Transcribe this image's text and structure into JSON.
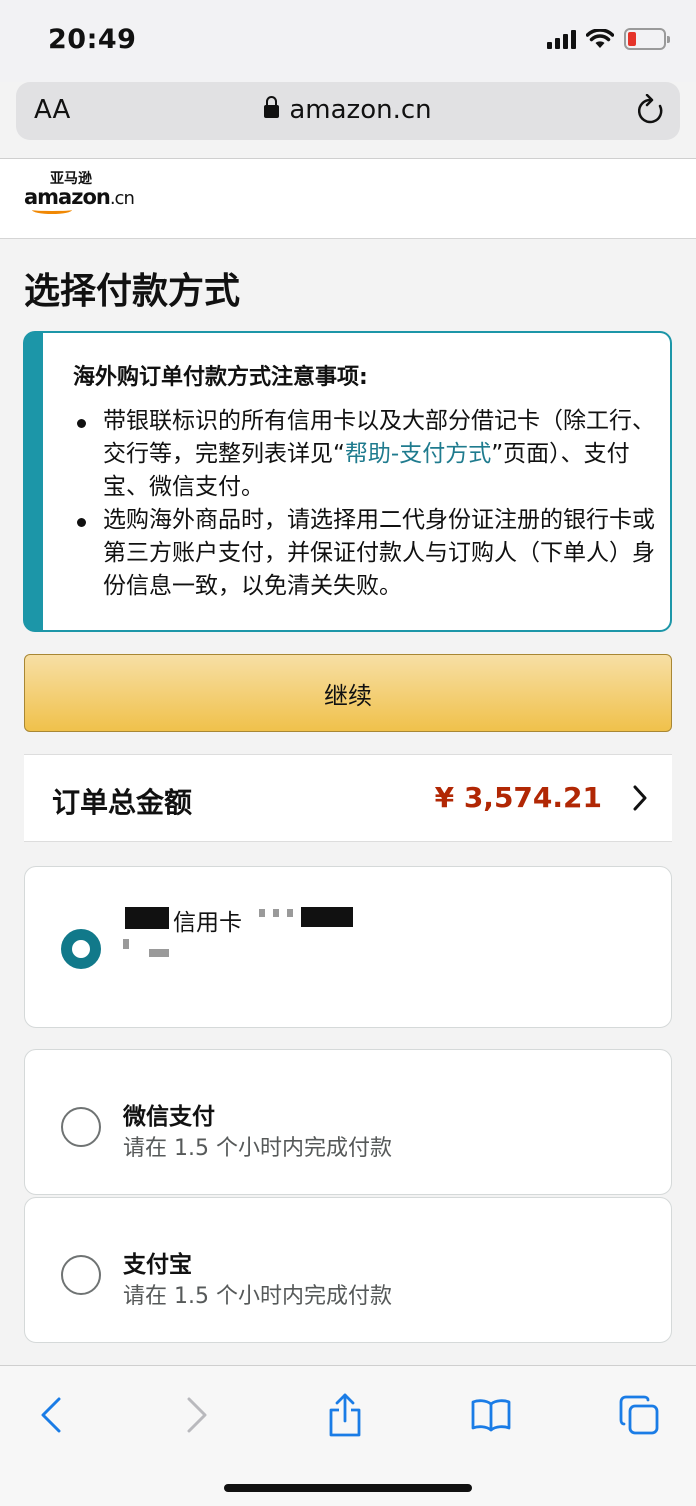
{
  "status_bar": {
    "time": "20:49",
    "battery_color": "#e5342a"
  },
  "browser": {
    "aa_label": "AA",
    "url": "amazon.cn"
  },
  "amazon": {
    "logo_cn": "亚马逊",
    "logo_word": "amazon",
    "logo_suffix": ".cn"
  },
  "page": {
    "title": "选择付款方式"
  },
  "notice": {
    "title": "海外购订单付款方式注意事项:",
    "item1_pre": "带银联标识的所有信用卡以及大部分借记卡（除工行、交行等，完整列表详见“",
    "item1_link": "帮助-支付方式",
    "item1_post": "”页面）、支付宝、微信支付。",
    "item2": "选购海外商品时，请选择用二代身份证注册的银行卡或第三方账户支付，并保证付款人与订购人（下单人）身份信息一致，以免清关失败。"
  },
  "continue_button": {
    "label": "继续"
  },
  "order_total": {
    "label": "订单总金额",
    "value": "¥ 3,574.21"
  },
  "payment_options": [
    {
      "title": "信用卡",
      "subtitle": "",
      "selected": true
    },
    {
      "title": "微信支付",
      "subtitle": "请在 1.5 个小时内完成付款",
      "selected": false
    },
    {
      "title": "支付宝",
      "subtitle": "请在 1.5 个小时内完成付款",
      "selected": false
    }
  ],
  "colors": {
    "accent": "#11798a",
    "price": "#b12704",
    "button": "#f0c14b",
    "link": "#1f7b8e"
  },
  "toolbar_icons": [
    "back-icon",
    "forward-icon",
    "share-icon",
    "bookmarks-icon",
    "tabs-icon"
  ]
}
